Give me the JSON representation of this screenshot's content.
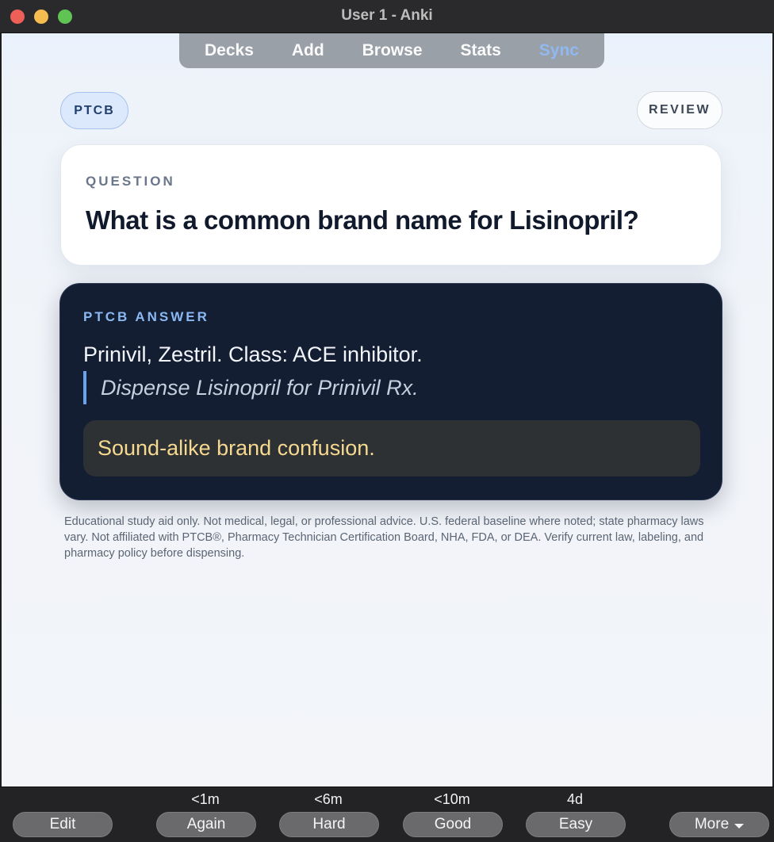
{
  "window": {
    "title": "User 1 - Anki"
  },
  "nav": {
    "decks": "Decks",
    "add": "Add",
    "browse": "Browse",
    "stats": "Stats",
    "sync": "Sync"
  },
  "card": {
    "deck": "PTCB",
    "mode": "REVIEW",
    "question_label": "QUESTION",
    "question": "What is a common brand name for Lisinopril?",
    "answer_label": "PTCB ANSWER",
    "answer": "Prinivil, Zestril. Class: ACE inhibitor.",
    "note": "Dispense Lisinopril for Prinivil Rx.",
    "warning": "Sound-alike brand confusion.",
    "disclaimer": "Educational study aid only. Not medical, legal, or professional advice. U.S. federal baseline where noted; state pharmacy laws vary. Not affiliated with PTCB®, Pharmacy Technician Certification Board, NHA, FDA, or DEA. Verify current law, labeling, and pharmacy policy before dispensing."
  },
  "bottom": {
    "edit": "Edit",
    "again": {
      "interval": "<1m",
      "label": "Again"
    },
    "hard": {
      "interval": "<6m",
      "label": "Hard"
    },
    "good": {
      "interval": "<10m",
      "label": "Good"
    },
    "easy": {
      "interval": "4d",
      "label": "Easy"
    },
    "more": "More"
  },
  "colors": {
    "accent": "#8fb9f0",
    "answer_bg": "#141e33",
    "warning_text": "#f6d990"
  }
}
